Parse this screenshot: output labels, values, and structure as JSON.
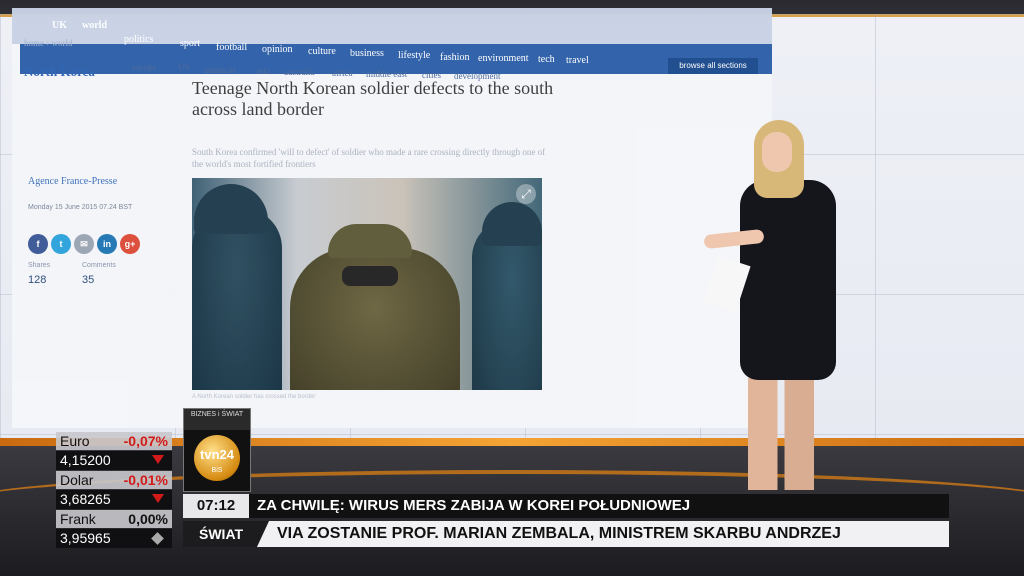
{
  "site": {
    "top_nav": [
      "UK",
      "world",
      "politics",
      "sport",
      "football",
      "opinion",
      "culture",
      "business",
      "lifestyle",
      "fashion",
      "environment",
      "tech",
      "travel"
    ],
    "breadcrumb": "home › world",
    "sub_nav": [
      "europe",
      "US",
      "americas",
      "asia",
      "australia",
      "africa",
      "middle east",
      "cities",
      "development"
    ],
    "browse_all": "browse all sections",
    "section": "North Korea",
    "headline": "Teenage North Korean soldier defects to the south across land border",
    "standfirst": "South Korea confirmed 'will to defect' of soldier who made a rare crossing directly through one of the world's most fortified frontiers",
    "byline": "Agence France-Presse",
    "dateline": "Monday 15 June 2015 07.24 BST",
    "share_icons": [
      "f",
      "t",
      "✉",
      "in",
      "g+"
    ],
    "shares_label": "Shares",
    "comments_label": "Comments",
    "shares": "128",
    "comments": "35",
    "photo_caption": "A North Korean soldier has crossed the border"
  },
  "currencies": [
    {
      "name": "Euro",
      "change": "-0,07%",
      "value": "4,15200",
      "direction": "down",
      "color": "#d21a1a"
    },
    {
      "name": "Dolar",
      "change": "-0,01%",
      "value": "3,68265",
      "direction": "down",
      "color": "#d21a1a"
    },
    {
      "name": "Frank",
      "change": "0,00%",
      "value": "3,95965",
      "direction": "flat",
      "color": "#111111"
    }
  ],
  "channel": {
    "top": "BIZNES i ŚWIAT",
    "logo": "tvn24",
    "sub": "BiS"
  },
  "ticker": {
    "time": "07:12",
    "now": "ZA CHWILĘ: WIRUS MERS ZABIJA W KOREI POŁUDNIOWEJ",
    "section": "ŚWIAT",
    "news": "VIA ZOSTANIE PROF. MARIAN ZEMBALA, MINISTREM SKARBU ANDRZEJ"
  }
}
